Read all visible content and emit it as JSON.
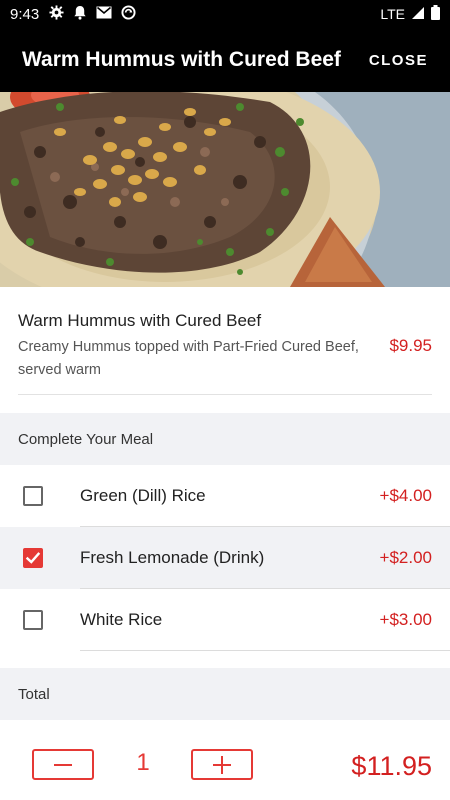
{
  "status_bar": {
    "time": "9:43",
    "icons": [
      "settings-icon",
      "notification-bell-icon",
      "gmail-icon",
      "sync-icon"
    ],
    "network": "LTE",
    "signal_icon": "signal-icon",
    "battery_icon": "battery-icon"
  },
  "header": {
    "title": "Warm Hummus with Cured Beef",
    "close_label": "CLOSE"
  },
  "hero_image": {
    "icon": "food-photo"
  },
  "item": {
    "name": "Warm Hummus with Cured Beef",
    "description": "Creamy Hummus topped with Part-Fried Cured Beef, served warm",
    "price": "$9.95"
  },
  "complete_meal": {
    "heading": "Complete Your Meal",
    "options": [
      {
        "label": "Green (Dill) Rice",
        "price": "+$4.00",
        "checked": false
      },
      {
        "label": "Fresh Lemonade (Drink)",
        "price": "+$2.00",
        "checked": true
      },
      {
        "label": "White Rice",
        "price": "+$3.00",
        "checked": false
      }
    ]
  },
  "total": {
    "heading": "Total",
    "quantity": "1",
    "amount": "$11.95"
  },
  "colors": {
    "accent": "#e53935",
    "price": "#d32020",
    "bar": "#000000",
    "section_bg": "#f1f2f5"
  }
}
